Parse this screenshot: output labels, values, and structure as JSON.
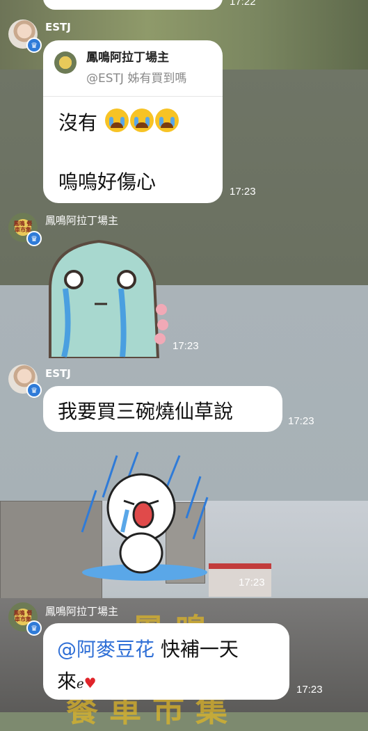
{
  "messages": {
    "top_time": "17:22",
    "m1": {
      "sender": "ESTJ",
      "reply_to_name": "鳳鳴阿拉丁場主",
      "reply_to_text": "@ESTJ 姊有買到嗎",
      "line1": "沒有",
      "line2": "嗚嗚好傷心",
      "time": "17:23"
    },
    "m2": {
      "sender": "鳳鳴阿拉丁場主",
      "sticker": "crying-dinosaur-sticker",
      "time": "17:23"
    },
    "m3": {
      "sender": "ESTJ",
      "text": "我要買三碗燒仙草說",
      "time": "17:23"
    },
    "m4": {
      "sender": "ESTJ",
      "sticker": "crying-rain-character-sticker",
      "time": "17:23"
    },
    "m5": {
      "sender": "鳳鳴阿拉丁場主",
      "mention": "@阿麥豆花",
      "text": " 快補一天",
      "text2": "來",
      "time": "17:23"
    },
    "avatar_shop_text": "鳳鳴 餐車市集"
  },
  "colors": {
    "mention": "#2f6fd6",
    "badge": "#2f7bd8"
  }
}
